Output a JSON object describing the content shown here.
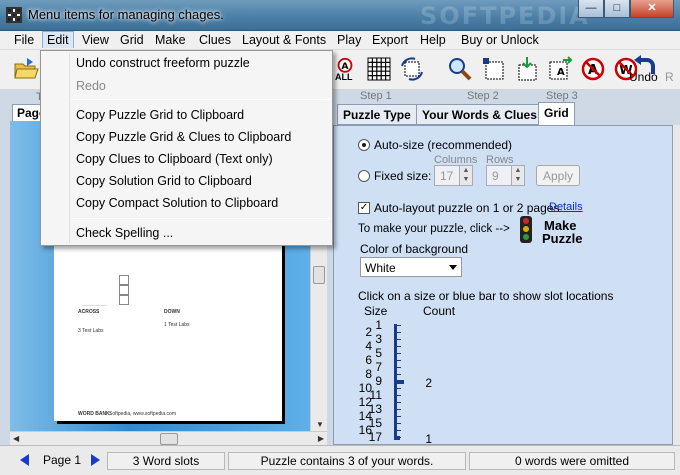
{
  "window": {
    "title": "Menu items for managing chages.",
    "watermark": "SOFTPEDIA"
  },
  "menubar": [
    "File",
    "Edit",
    "View",
    "Grid",
    "Make",
    "Clues",
    "Layout & Fonts",
    "Play",
    "Export",
    "Help",
    "Buy or Unlock"
  ],
  "edit_menu": {
    "undo": "Undo construct freeform puzzle",
    "redo": "Redo",
    "copy_grid": "Copy Puzzle Grid to Clipboard",
    "copy_grid_clues": "Copy Puzzle Grid & Clues to Clipboard",
    "copy_clues": "Copy Clues to Clipboard (Text only)",
    "copy_solution": "Copy Solution Grid to Clipboard",
    "copy_compact": "Copy Compact Solution to Clipboard",
    "check_spelling": "Check Spelling ..."
  },
  "toolbar": {
    "all_label": "ALL",
    "undo_label": "Undo"
  },
  "left": {
    "tab_label": "Page",
    "step_partial": "T",
    "paper": {
      "across": "ACROSS",
      "down": "DOWN",
      "across_clue": "3  Test Labs",
      "down_clue": "1  Test Labs",
      "word_bank": "WORD BANK:",
      "word_bank_val": "Softpedia, www.softpedia.com"
    }
  },
  "right": {
    "steps": [
      "Step 1",
      "Step 2",
      "Step 3"
    ],
    "tabs": [
      "Puzzle Type",
      "Your Words & Clues",
      "Grid"
    ],
    "auto_size": "Auto-size  (recommended)",
    "fixed_size": "Fixed size:",
    "columns_label": "Columns",
    "rows_label": "Rows",
    "columns_value": "17",
    "rows_value": "9",
    "apply": "Apply",
    "auto_layout": "Auto-layout puzzle on 1 or 2 pages.",
    "details": "Details",
    "make_hint": "To make your puzzle, click -->",
    "make_btn_line1": "Make",
    "make_btn_line2": "Puzzle",
    "bg_color_label": "Color of background",
    "bg_color_value": "White",
    "slot_hint": "Click on a size or blue bar to show slot locations",
    "size_header": "Size",
    "count_header": "Count",
    "sizes": [
      "1",
      "2",
      "3",
      "4",
      "5",
      "6",
      "7",
      "8",
      "9",
      "10",
      "11",
      "12",
      "13",
      "14",
      "15",
      "16",
      "17"
    ],
    "counts": [
      {
        "size": 9,
        "count": "2"
      },
      {
        "size": 17,
        "count": "1"
      }
    ]
  },
  "status": {
    "page": "Page 1",
    "word_slots": "3 Word slots",
    "contains": "Puzzle contains 3 of your words.",
    "omitted": "0 words were omitted"
  },
  "colors": {
    "accent": "#1a3a8c",
    "title_gradient_top": "#6f9bbd",
    "panel": "#cfe0f5"
  }
}
